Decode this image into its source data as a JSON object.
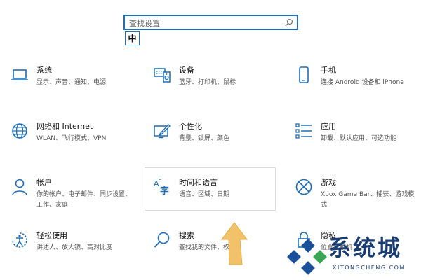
{
  "search": {
    "placeholder": "查找设置"
  },
  "ime": {
    "label": "中"
  },
  "tiles": [
    {
      "title": "系统",
      "desc": "显示、声音、通知、电源"
    },
    {
      "title": "设备",
      "desc": "蓝牙、打印机、鼠标"
    },
    {
      "title": "手机",
      "desc": "连接 Android 设备和 iPhone"
    },
    {
      "title": "网络和 Internet",
      "desc": "WLAN、飞行模式、VPN"
    },
    {
      "title": "个性化",
      "desc": "背景、锁屏、颜色"
    },
    {
      "title": "应用",
      "desc": "卸载、默认应用、可选功能"
    },
    {
      "title": "帐户",
      "desc": "你的帐户、电子邮件、同步设置、工作、家庭"
    },
    {
      "title": "时间和语言",
      "desc": "语音、区域、日期"
    },
    {
      "title": "游戏",
      "desc": "Xbox Game Bar、捕获、游戏模式"
    },
    {
      "title": "轻松使用",
      "desc": "讲述人、放大镜、高对比度"
    },
    {
      "title": "搜索",
      "desc": "查找我的文件、权限"
    },
    {
      "title": "隐私",
      "desc": "位置、相机"
    }
  ],
  "watermark": {
    "brand": "系统城",
    "url": "XITONGCHENG.COM"
  },
  "colors": {
    "accent": "#1f6fb8",
    "arrow": "#f2c26b",
    "watermark": "#1a3e73"
  }
}
